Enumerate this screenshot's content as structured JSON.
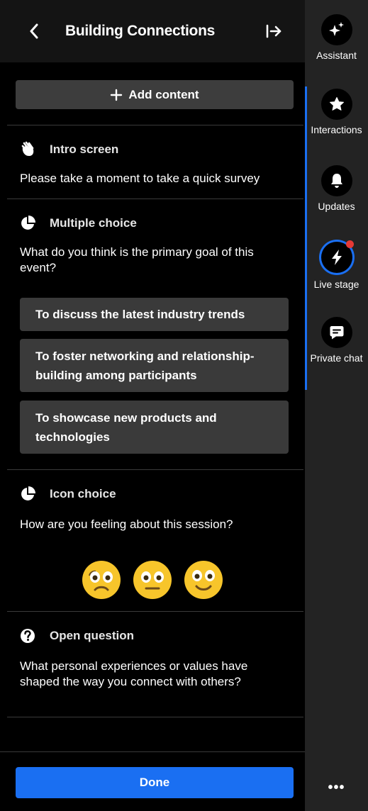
{
  "header": {
    "title": "Building Connections"
  },
  "toolbar": {
    "add_label": "Add content"
  },
  "sections": {
    "intro": {
      "title": "Intro screen",
      "text": "Please take a moment to take a quick survey"
    },
    "multiple": {
      "title": "Multiple choice",
      "question": "What do you think is the primary goal of this event?",
      "options": [
        "To discuss the latest industry trends",
        "To foster networking and relationship-building among participants",
        "To showcase new products and technologies"
      ]
    },
    "icon": {
      "title": "Icon choice",
      "question": "How are you feeling about this session?",
      "emojis": [
        "frowning-face-icon",
        "neutral-face-icon",
        "smiling-face-icon"
      ]
    },
    "open": {
      "title": "Open question",
      "question": "What personal experiences or values have shaped the way you connect with others?"
    }
  },
  "footer": {
    "done_label": "Done"
  },
  "rail": {
    "items": [
      {
        "label": "Assistant",
        "icon": "sparkle-icon"
      },
      {
        "label": "Interactions",
        "icon": "star-icon"
      },
      {
        "label": "Updates",
        "icon": "bell-icon"
      },
      {
        "label": "Live stage",
        "icon": "lightning-icon"
      },
      {
        "label": "Private chat",
        "icon": "chat-icon"
      }
    ],
    "more_label": "•••"
  },
  "colors": {
    "accent": "#1a6ff2",
    "notification": "#e53935",
    "emoji_yellow": "#f7c52b"
  }
}
